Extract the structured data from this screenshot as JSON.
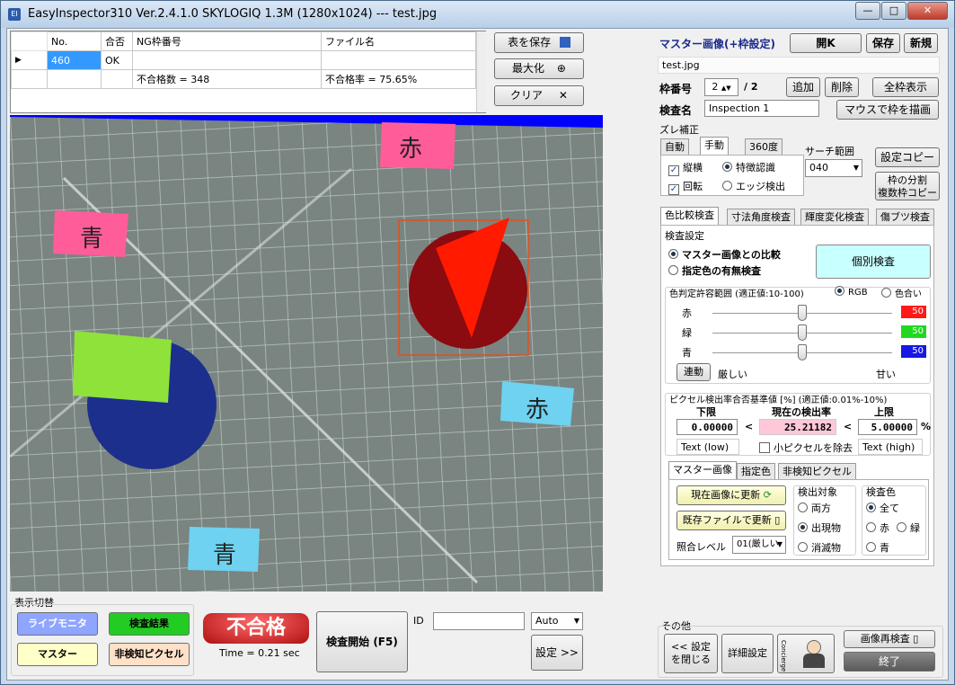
{
  "window": {
    "title": "EasyInspector310 Ver.2.4.1.0 SKYLOGIQ 1.3M  (1280x1024) --- test.jpg",
    "app_icon": "EI",
    "minimize": "—",
    "maximize": "□",
    "close": "✕"
  },
  "results_table": {
    "headers": [
      "No.",
      "合否",
      "NG枠番号",
      "ファイル名"
    ],
    "row1": {
      "no": "460",
      "result": "OK",
      "ng": "",
      "file": ""
    },
    "row2": {
      "ng": "不合格数 = 348",
      "file": "不合格率 = 75.65%"
    }
  },
  "table_buttons": {
    "save": "表を保存",
    "maximize": "最大化",
    "clear": "クリア"
  },
  "master": {
    "title": "マスター画像(+枠設定)",
    "open_btn": "開K",
    "save_btn": "保存",
    "new_btn": "新規",
    "filename": "test.jpg",
    "frame_label": "枠番号",
    "frame_value": "2",
    "frame_total": "/ 2",
    "add_btn": "追加",
    "delete_btn": "削除",
    "show_all_btn": "全枠表示",
    "inspect_name_label": "検査名",
    "inspect_name_value": "Inspection 1",
    "draw_frame_btn": "マウスで枠を描画"
  },
  "shift": {
    "group_label": "ズレ補正",
    "tabs": [
      "自動",
      "手動",
      "360度"
    ],
    "vertical": "縦横",
    "rotation": "回転",
    "feature": "特徴認識",
    "edge": "エッジ検出",
    "search_label": "サーチ範囲",
    "search_value": "040",
    "copy_settings": "設定コピー",
    "split_l1": "枠の分割",
    "split_l2": "複数枠コピー"
  },
  "inspect_tabs": [
    "色比較検査",
    "寸法角度検査",
    "輝度変化検査",
    "傷ブツ検査"
  ],
  "settings": {
    "group_label": "検査設定",
    "master_compare": "マスター画像との比較",
    "color_presence": "指定色の有無検査",
    "individual_btn": "個別検査",
    "tolerance_label": "色判定許容範囲 (適正値:10-100)",
    "rgb": "RGB",
    "hue": "色合い",
    "red_label": "赤",
    "green_label": "緑",
    "blue_label": "青",
    "red_value": "50",
    "green_value": "50",
    "blue_value": "50",
    "red_level": 0.5,
    "green_level": 0.5,
    "blue_level": 0.5,
    "link_btn": "連動",
    "strict": "厳しい",
    "loose": "甘い"
  },
  "pixel": {
    "group_label": "ピクセル検出率合否基準値 [%] (適正値:0.01%-10%)",
    "lower_label": "下限",
    "current_label": "現在の検出率",
    "upper_label": "上限",
    "lower_value": "0.00000",
    "current_value": "25.21182",
    "upper_value": "5.00000",
    "lt1": "<",
    "lt2": "<",
    "pct": "%",
    "text_low": "Text (low)",
    "text_high": "Text (high)",
    "remove_small": "小ピクセルを除去"
  },
  "sub_tabs": [
    "マスター画像",
    "指定色",
    "非検知ピクセル"
  ],
  "master_sub": {
    "update_current": "現在画像に更新",
    "update_file": "既存ファイルで更新",
    "match_label": "照合レベル",
    "match_value": "01(厳しい",
    "target_label": "検出対象",
    "both": "両方",
    "appeared": "出現物",
    "disappeared": "消滅物",
    "color_label": "検査色",
    "all": "全て",
    "red": "赤",
    "green": "緑",
    "blue": "青"
  },
  "display": {
    "label": "表示切替",
    "live": "ライブモニタ",
    "result": "検査結果",
    "master": "マスター",
    "nondetect": "非検知ピクセル"
  },
  "judge": {
    "result": "不合格",
    "time": "Time = 0.21 sec",
    "start_btn": "検査開始 (F5)",
    "id_label": "ID",
    "id_value": "",
    "auto_value": "Auto",
    "settings_btn": "設定 >>"
  },
  "other": {
    "label": "その他",
    "close_settings_l1": "<< 設定",
    "close_settings_l2": "を閉じる",
    "detail": "詳細設定",
    "concierge": "Concierge",
    "reinspect": "画像再検査",
    "exit": "終了"
  },
  "image_labels": {
    "label1": "赤",
    "label2": "青",
    "label3": "赤",
    "label4": "青"
  },
  "colors": {
    "red_sw": "#ff1a1a",
    "green_sw": "#1fd81f",
    "blue_sw": "#1717e6",
    "fail": "#d02020",
    "live": "#8fa5ff",
    "result": "#22cc22",
    "master": "#ffffc8",
    "nondetect": "#ffe0c8",
    "individual": "#c8ffff"
  }
}
